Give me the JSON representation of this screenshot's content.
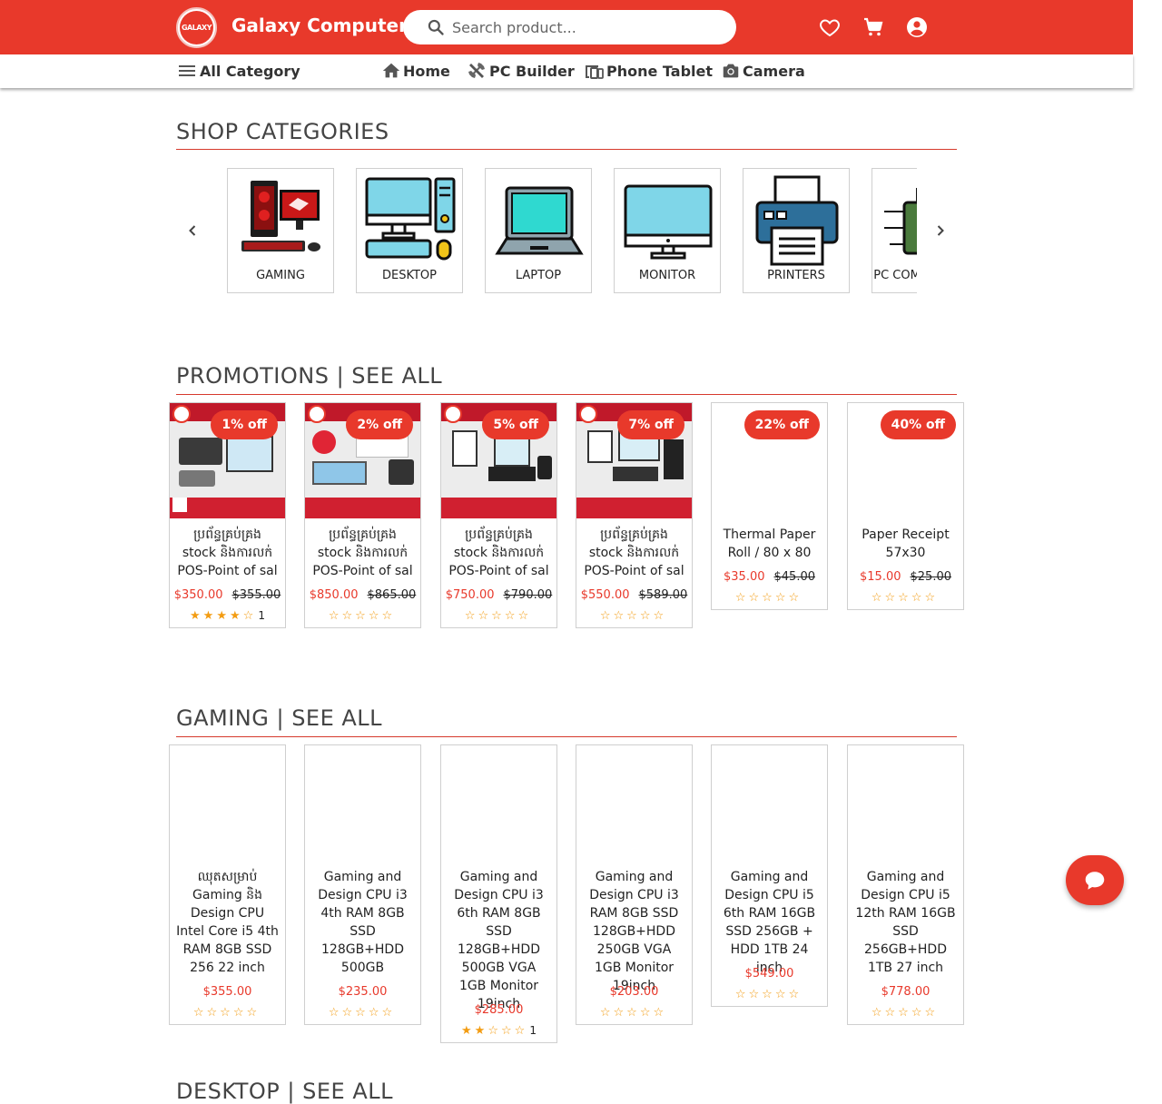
{
  "header": {
    "logo_text": "GALAXY",
    "brand": "Galaxy Computer",
    "search_placeholder": "Search product...",
    "icons": [
      "heart-icon",
      "cart-icon",
      "account-icon"
    ],
    "accent_color": "#e8392b"
  },
  "nav": {
    "all_category": "All Category",
    "home": "Home",
    "pc_builder": "PC Builder",
    "phone_tablet": "Phone Tablet",
    "camera": "Camera"
  },
  "shop_categories": {
    "title": "SHOP CATEGORIES",
    "items": [
      {
        "label": "GAMING"
      },
      {
        "label": "DESKTOP"
      },
      {
        "label": "LAPTOP"
      },
      {
        "label": "MONITOR"
      },
      {
        "label": "PRINTERS"
      },
      {
        "label": "PC COMPONENTS"
      }
    ]
  },
  "promotions": {
    "title": "PROMOTIONS | SEE ALL",
    "items": [
      {
        "badge": "1% off",
        "name": "ប្រព័ន្ធគ្រប់គ្រង stock និងការលក់ POS-Point of sal",
        "price": "$350.00",
        "old_price": "$355.00",
        "stars": "★★★★☆",
        "rating_count": "1"
      },
      {
        "badge": "2% off",
        "name": "ប្រព័ន្ធគ្រប់គ្រង stock និងការលក់ POS-Point of sal",
        "price": "$850.00",
        "old_price": "$865.00",
        "stars": "☆☆☆☆☆",
        "rating_count": ""
      },
      {
        "badge": "5% off",
        "name": "ប្រព័ន្ធគ្រប់គ្រង stock និងការលក់ POS-Point of sal",
        "price": "$750.00",
        "old_price": "$790.00",
        "stars": "☆☆☆☆☆",
        "rating_count": ""
      },
      {
        "badge": "7% off",
        "name": "ប្រព័ន្ធគ្រប់គ្រង stock និងការលក់ POS-Point of sal",
        "price": "$550.00",
        "old_price": "$589.00",
        "stars": "☆☆☆☆☆",
        "rating_count": ""
      },
      {
        "badge": "22% off",
        "name": "Thermal Paper Roll / 80 x 80",
        "price": "$35.00",
        "old_price": "$45.00",
        "stars": "☆☆☆☆☆",
        "rating_count": ""
      },
      {
        "badge": "40% off",
        "name": "Paper Receipt 57x30",
        "price": "$15.00",
        "old_price": "$25.00",
        "stars": "☆☆☆☆☆",
        "rating_count": ""
      }
    ]
  },
  "gaming": {
    "title": "GAMING | SEE ALL",
    "items": [
      {
        "name": "ឈុតសម្រាប់ Gaming និង Design CPU Intel Core i5 4th RAM 8GB SSD 256 22 inch",
        "price": "$355.00",
        "stars": "☆☆☆☆☆",
        "rating_count": ""
      },
      {
        "name": "Gaming and Design CPU i3 4th RAM 8GB SSD 128GB+HDD 500GB",
        "price": "$235.00",
        "stars": "☆☆☆☆☆",
        "rating_count": ""
      },
      {
        "name": "Gaming and Design CPU i3 6th RAM 8GB SSD 128GB+HDD 500GB VGA 1GB Monitor 19inch",
        "price": "$285.00",
        "stars": "★★☆☆☆",
        "rating_count": "1"
      },
      {
        "name": "Gaming and Design CPU i3 RAM 8GB SSD 128GB+HDD 250GB VGA 1GB Monitor 19inch",
        "price": "$203.00",
        "stars": "☆☆☆☆☆",
        "rating_count": ""
      },
      {
        "name": "Gaming and Design CPU i5 6th RAM 16GB SSD 256GB + HDD 1TB 24 inch",
        "price": "$549.00",
        "stars": "☆☆☆☆☆",
        "rating_count": ""
      },
      {
        "name": "Gaming and Design CPU i5 12th RAM 16GB SSD 256GB+HDD 1TB 27 inch",
        "price": "$778.00",
        "stars": "☆☆☆☆☆",
        "rating_count": ""
      }
    ]
  },
  "next_section": {
    "title": "DESKTOP | SEE ALL"
  },
  "chat_icon": "chat-bubble-icon"
}
